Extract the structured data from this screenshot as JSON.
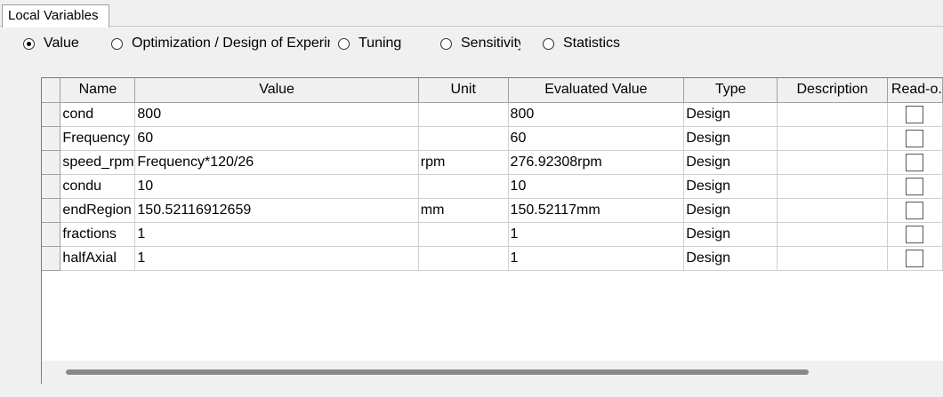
{
  "tab": {
    "label": "Local Variables"
  },
  "radio_options": [
    {
      "label": "Value",
      "selected": true
    },
    {
      "label": "Optimization / Design of Experiments",
      "selected": false
    },
    {
      "label": "Tuning",
      "selected": false
    },
    {
      "label": "Sensitivity",
      "selected": false
    },
    {
      "label": "Statistics",
      "selected": false
    }
  ],
  "grid": {
    "columns": [
      "Name",
      "Value",
      "Unit",
      "Evaluated Value",
      "Type",
      "Description",
      "Read-o."
    ],
    "rows": [
      {
        "name": "cond",
        "value": "800",
        "unit": "",
        "evaluated": "800",
        "type": "Design",
        "description": "",
        "read_only": false
      },
      {
        "name": "Frequency",
        "value": "60",
        "unit": "",
        "evaluated": "60",
        "type": "Design",
        "description": "",
        "read_only": false
      },
      {
        "name": "speed_rpm",
        "value": "Frequency*120/26",
        "unit": "rpm",
        "evaluated": "276.92308rpm",
        "type": "Design",
        "description": "",
        "read_only": false
      },
      {
        "name": "condu",
        "value": "10",
        "unit": "",
        "evaluated": "10",
        "type": "Design",
        "description": "",
        "read_only": false
      },
      {
        "name": "endRegion",
        "value": "150.52116912659",
        "unit": "mm",
        "evaluated": "150.52117mm",
        "type": "Design",
        "description": "",
        "read_only": false
      },
      {
        "name": "fractions",
        "value": "1",
        "unit": "",
        "evaluated": "1",
        "type": "Design",
        "description": "",
        "read_only": false
      },
      {
        "name": "halfAxial",
        "value": "1",
        "unit": "",
        "evaluated": "1",
        "type": "Design",
        "description": "",
        "read_only": false
      }
    ]
  }
}
